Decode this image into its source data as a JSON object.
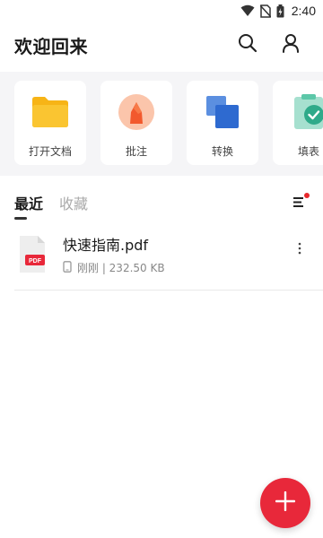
{
  "status_bar": {
    "time": "2:40",
    "icons": [
      "wifi-icon",
      "no-sim-icon",
      "battery-charging-icon"
    ]
  },
  "header": {
    "title": "欢迎回来",
    "icons": [
      "search-icon",
      "user-icon"
    ]
  },
  "tools": [
    {
      "label": "打开文档",
      "icon": "folder-icon",
      "color": "#f7b416"
    },
    {
      "label": "批注",
      "icon": "annotate-icon",
      "color": "#f26b3a"
    },
    {
      "label": "转换",
      "icon": "convert-icon",
      "color": "#3a78d6"
    },
    {
      "label": "填表",
      "icon": "form-icon",
      "color": "#34b59a"
    }
  ],
  "tabs": [
    {
      "label": "最近",
      "active": true
    },
    {
      "label": "收藏",
      "active": false
    }
  ],
  "files": [
    {
      "name": "快速指南.pdf",
      "meta": "刚刚 | 232.50 KB",
      "badge": "PDF"
    }
  ],
  "colors": {
    "accent": "#e8283a",
    "tools_bg": "#f5f5f7"
  }
}
